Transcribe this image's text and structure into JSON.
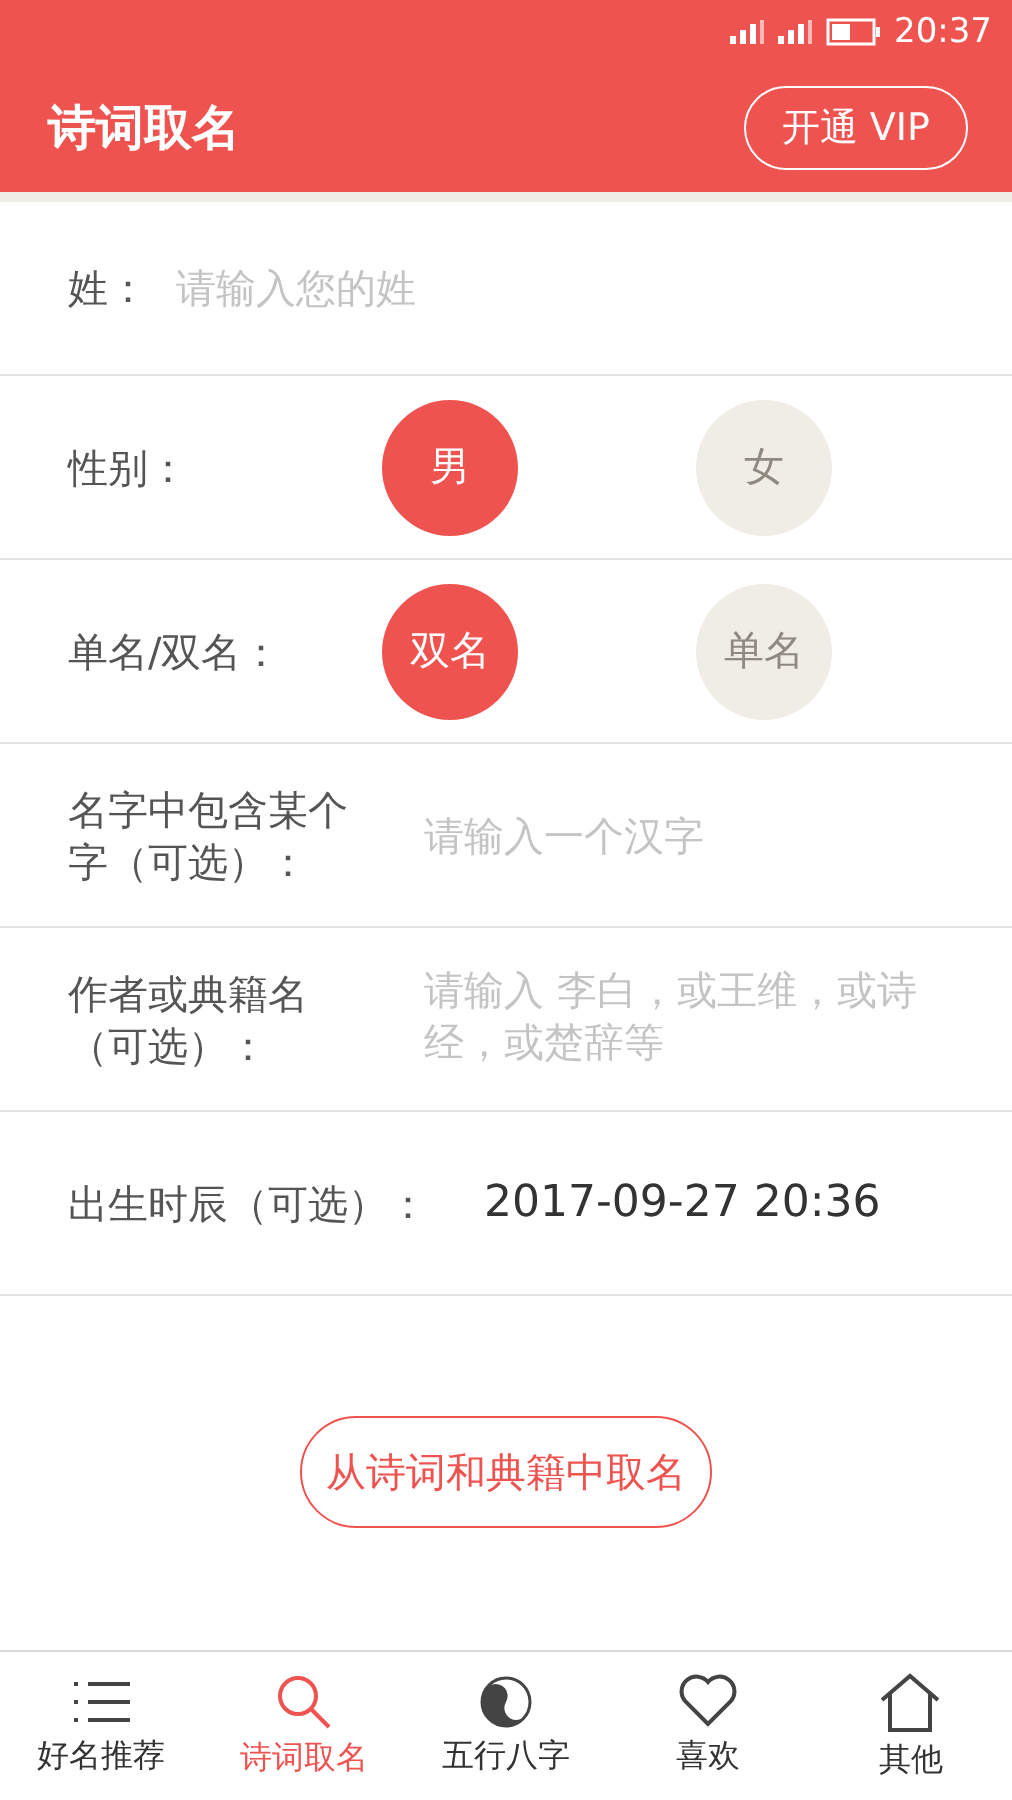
{
  "status_bar": {
    "time": "20:37"
  },
  "header": {
    "title": "诗词取名",
    "vip_button": "开通 VIP"
  },
  "form": [
    {
      "kind": "input",
      "label": "姓：",
      "placeholder": "请输入您的姓"
    },
    {
      "kind": "choice",
      "label": "性别：",
      "options": [
        {
          "label": "男",
          "selected": true
        },
        {
          "label": "女",
          "selected": false
        }
      ]
    },
    {
      "kind": "choice",
      "label": "单名/双名：",
      "options": [
        {
          "label": "双名",
          "selected": true
        },
        {
          "label": "单名",
          "selected": false
        }
      ]
    },
    {
      "kind": "input",
      "label": "名字中包含某个字（可选）：",
      "placeholder": "请输入一个汉字"
    },
    {
      "kind": "input",
      "label": "作者或典籍名（可选）：",
      "placeholder": "请输入 李白，或王维，或诗经，或楚辞等"
    },
    {
      "kind": "value",
      "label": "出生时辰（可选）：",
      "value": "2017-09-27 20:36"
    }
  ],
  "submit_button": "从诗词和典籍中取名",
  "tabs": [
    {
      "label": "好名推荐",
      "selected": false
    },
    {
      "label": "诗词取名",
      "selected": true
    },
    {
      "label": "五行八字",
      "selected": false
    },
    {
      "label": "喜欢",
      "selected": false
    },
    {
      "label": "其他",
      "selected": false
    }
  ]
}
